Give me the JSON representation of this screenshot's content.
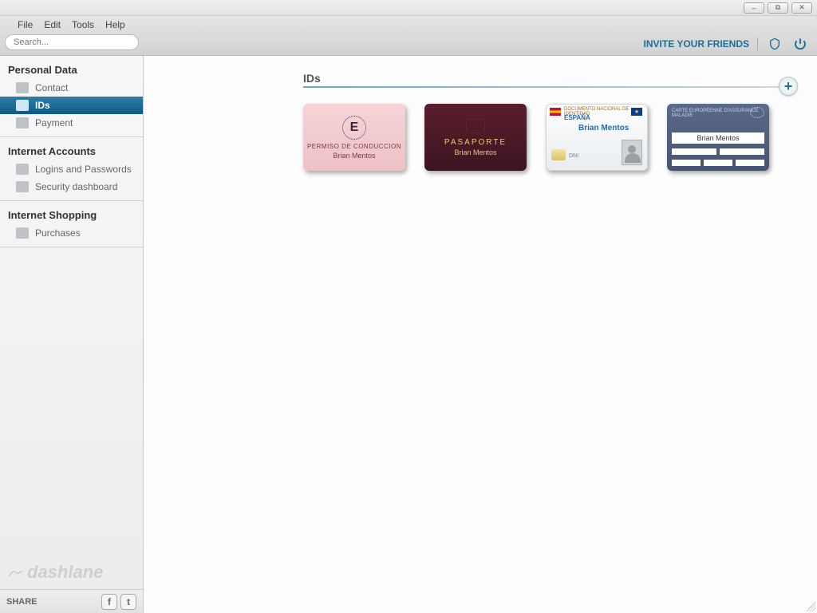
{
  "window": {
    "min": "–",
    "max": "⧉",
    "close": "✕"
  },
  "menu": {
    "file": "File",
    "edit": "Edit",
    "tools": "Tools",
    "help": "Help"
  },
  "search": {
    "placeholder": "Search..."
  },
  "header": {
    "invite": "INVITE YOUR FRIENDS"
  },
  "sidebar": {
    "sections": [
      {
        "title": "Personal Data",
        "items": [
          {
            "label": "Contact",
            "icon": "contact"
          },
          {
            "label": "IDs",
            "icon": "id",
            "active": true
          },
          {
            "label": "Payment",
            "icon": "payment"
          }
        ]
      },
      {
        "title": "Internet Accounts",
        "items": [
          {
            "label": "Logins and Passwords",
            "icon": "lock"
          },
          {
            "label": "Security dashboard",
            "icon": "shield"
          }
        ]
      },
      {
        "title": "Internet Shopping",
        "items": [
          {
            "label": "Purchases",
            "icon": "bag"
          }
        ]
      }
    ],
    "brand": "dashlane",
    "share_label": "SHARE"
  },
  "page": {
    "title": "IDs",
    "cards": [
      {
        "kind": "driver",
        "type_label": "PERMISO DE CONDUCCION",
        "name": "Brian Mentos"
      },
      {
        "kind": "passport",
        "type_label": "PASAPORTE",
        "name": "Brian Mentos"
      },
      {
        "kind": "idcard",
        "country": "ESPAÑA",
        "header": "DOCUMENTO NACIONAL DE IDENTIDAD",
        "dni": "DNI",
        "name": "Brian Mentos"
      },
      {
        "kind": "social",
        "header": "CARTE EUROPÉENNE D'ASSURANCE MALADIE",
        "name": "Brian Mentos"
      }
    ]
  }
}
